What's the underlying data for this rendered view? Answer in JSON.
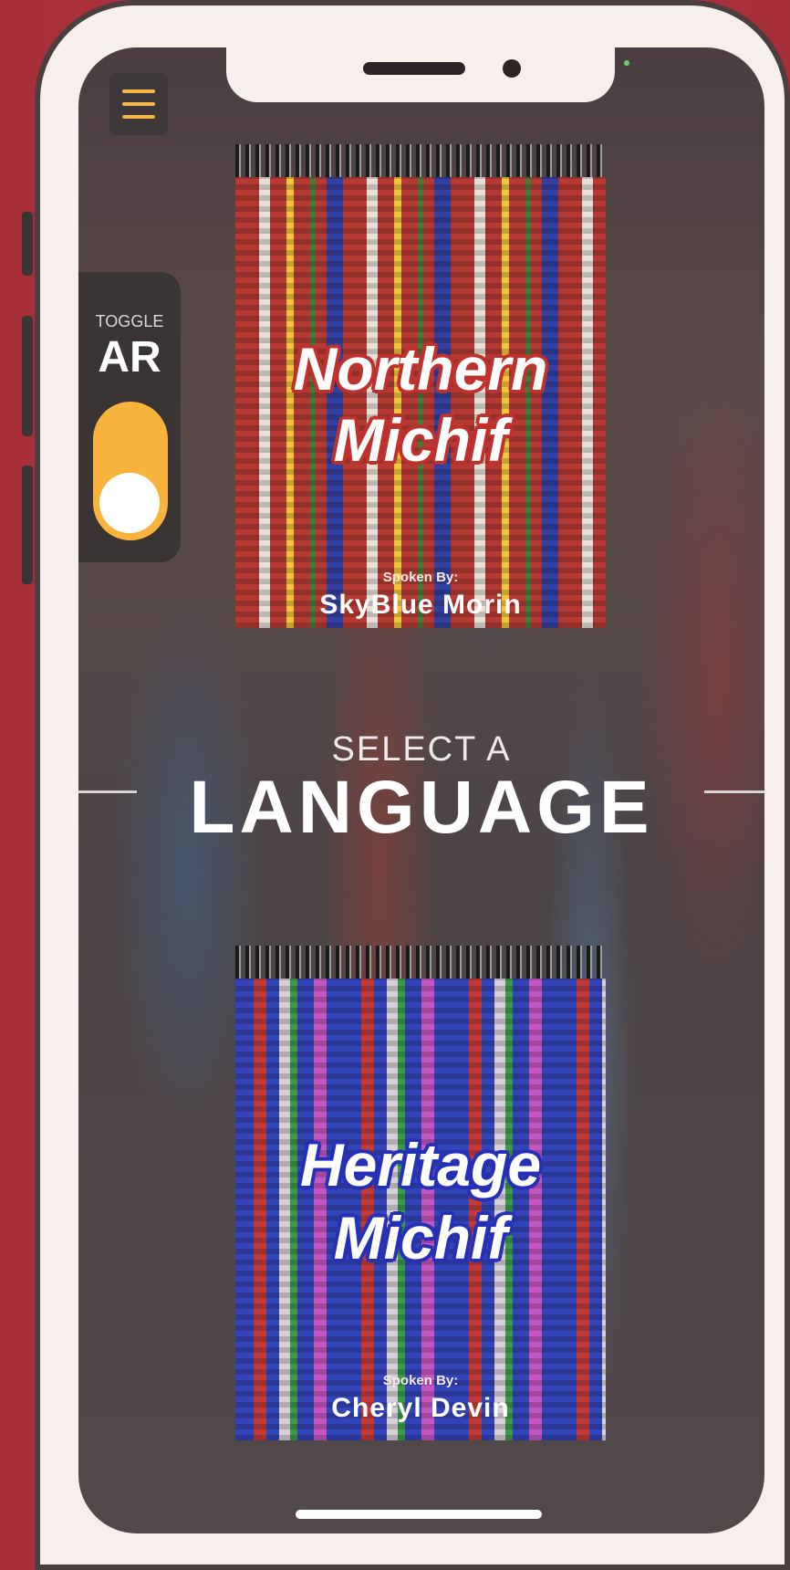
{
  "toggle": {
    "small_label": "TOGGLE",
    "big_label": "AR",
    "state": "on",
    "color": "#f7b43c"
  },
  "heading": {
    "line1": "SELECT A",
    "line2": "LANGUAGE"
  },
  "books": [
    {
      "title_line1": "Northern",
      "title_line2": "Michif",
      "spoken_by_label": "Spoken By:",
      "speaker": "SkyBlue Morin",
      "cover_color": "#b53a33"
    },
    {
      "title_line1": "Heritage",
      "title_line2": "Michif",
      "spoken_by_label": "Spoken By:",
      "speaker": "Cheryl Devin",
      "cover_color": "#3343b8"
    }
  ],
  "icons": {
    "menu": "hamburger-menu-icon"
  },
  "accent_color": "#f3b64a"
}
